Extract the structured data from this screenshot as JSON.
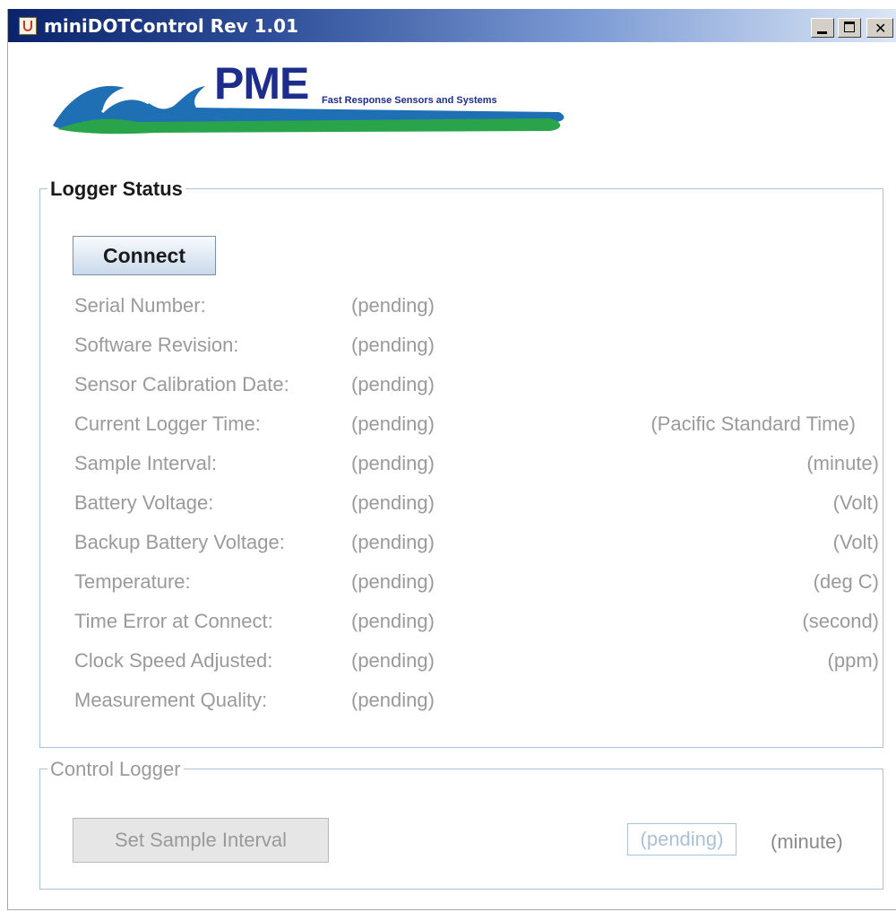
{
  "window": {
    "title": "miniDOTControl Rev 1.01",
    "icons": {
      "app": "java-cup-icon",
      "minimize": "minimize-icon",
      "maximize": "maximize-icon",
      "close": "close-icon"
    }
  },
  "logo": {
    "word": "PME",
    "tagline": "Fast Response Sensors and Systems",
    "colors": {
      "wave_blue": "#1f6fb5",
      "wave_green": "#2aa44a",
      "text": "#1d2d8c"
    }
  },
  "logger_status": {
    "title": "Logger Status",
    "connect_label": "Connect",
    "rows": [
      {
        "label": "Serial Number:",
        "value": "(pending)",
        "unit": ""
      },
      {
        "label": "Software Revision:",
        "value": "(pending)",
        "unit": ""
      },
      {
        "label": "Sensor Calibration Date:",
        "value": "(pending)",
        "unit": ""
      },
      {
        "label": "Current Logger Time:",
        "value": "(pending)",
        "unit": "(Pacific Standard Time)"
      },
      {
        "label": "Sample Interval:",
        "value": "(pending)",
        "unit": "(minute)"
      },
      {
        "label": "Battery Voltage:",
        "value": "(pending)",
        "unit": "(Volt)"
      },
      {
        "label": "Backup Battery Voltage:",
        "value": "(pending)",
        "unit": "(Volt)"
      },
      {
        "label": "Temperature:",
        "value": "(pending)",
        "unit": "(deg C)"
      },
      {
        "label": "Time Error at Connect:",
        "value": "(pending)",
        "unit": "(second)"
      },
      {
        "label": "Clock Speed Adjusted:",
        "value": "(pending)",
        "unit": "(ppm)"
      },
      {
        "label": "Measurement Quality:",
        "value": "(pending)",
        "unit": ""
      }
    ]
  },
  "control_logger": {
    "title": "Control Logger",
    "set_interval_label": "Set Sample Interval",
    "interval_placeholder": "(pending)",
    "interval_unit": "(minute)"
  }
}
